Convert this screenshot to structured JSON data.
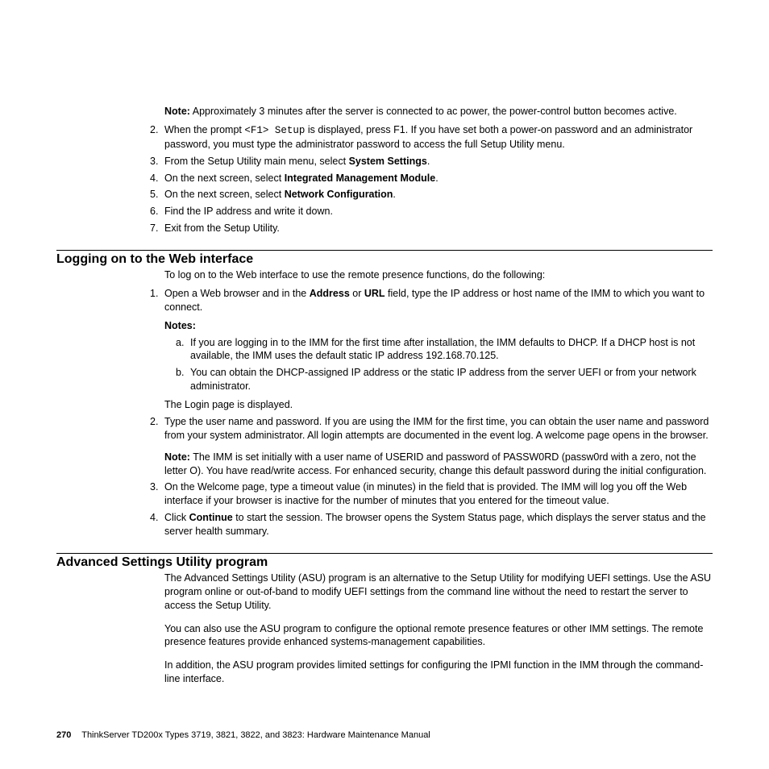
{
  "top": {
    "note_prefix": "Note:",
    "note_body": " Approximately 3 minutes after the server is connected to ac power, the power-control button becomes active.",
    "li2_pre": "When the prompt ",
    "li2_code": "<F1> Setup",
    "li2_post": " is displayed, press F1. If you have set both a power-on password and an administrator password, you must type the administrator password to access the full Setup Utility menu.",
    "li3_pre": "From the Setup Utility main menu, select ",
    "li3_bold": "System Settings",
    "li3_post": ".",
    "li4_pre": "On the next screen, select ",
    "li4_bold": "Integrated Management Module",
    "li4_post": ".",
    "li5_pre": "On the next screen, select ",
    "li5_bold": "Network Configuration",
    "li5_post": ".",
    "li6": "Find the IP address and write it down.",
    "li7": "Exit from the Setup Utility."
  },
  "sec1": {
    "title": "Logging on to the Web interface",
    "intro": "To log on to the Web interface to use the remote presence functions, do the following:",
    "li1_pre": "Open a Web browser and in the ",
    "li1_b1": "Address",
    "li1_mid": " or ",
    "li1_b2": "URL",
    "li1_post": " field, type the IP address or host name of the IMM to which you want to connect.",
    "notes_label": "Notes:",
    "na": "If you are logging in to the IMM for the first time after installation, the IMM defaults to DHCP. If a DHCP host is not available, the IMM uses the default static IP address 192.168.70.125.",
    "nb": "You can obtain the DHCP-assigned IP address or the static IP address from the server UEFI or from your network administrator.",
    "after_notes": "The Login page is displayed.",
    "li2": "Type the user name and password. If you are using the IMM for the first time, you can obtain the user name and password from your system administrator. All login attempts are documented in the event log. A welcome page opens in the browser.",
    "li2_note_prefix": "Note:",
    "li2_note_body": " The IMM is set initially with a user name of USERID and password of PASSW0RD (passw0rd with a zero, not the letter O). You have read/write access. For enhanced security, change this default password during the initial configuration.",
    "li3": "On the Welcome page, type a timeout value (in minutes) in the field that is provided. The IMM will log you off the Web interface if your browser is inactive for the number of minutes that you entered for the timeout value.",
    "li4_pre": "Click ",
    "li4_bold": "Continue",
    "li4_post": " to start the session. The browser opens the System Status page, which displays the server status and the server health summary."
  },
  "sec2": {
    "title": "Advanced Settings Utility program",
    "p1": "The Advanced Settings Utility (ASU) program is an alternative to the Setup Utility for modifying UEFI settings. Use the ASU program online or out-of-band to modify UEFI settings from the command line without the need to restart the server to access the Setup Utility.",
    "p2": "You can also use the ASU program to configure the optional remote presence features or other IMM settings. The remote presence features provide enhanced systems-management capabilities.",
    "p3": "In addition, the ASU program provides limited settings for configuring the IPMI function in the IMM through the command-line interface."
  },
  "footer": {
    "page": "270",
    "text": "ThinkServer TD200x Types 3719, 3821, 3822, and 3823: Hardware Maintenance Manual"
  },
  "nums": {
    "n2": "2.",
    "n3": "3.",
    "n4": "4.",
    "n5": "5.",
    "n6": "6.",
    "n7": "7.",
    "s1": "1.",
    "s2": "2.",
    "s3": "3.",
    "s4": "4.",
    "a": "a.",
    "b": "b."
  }
}
